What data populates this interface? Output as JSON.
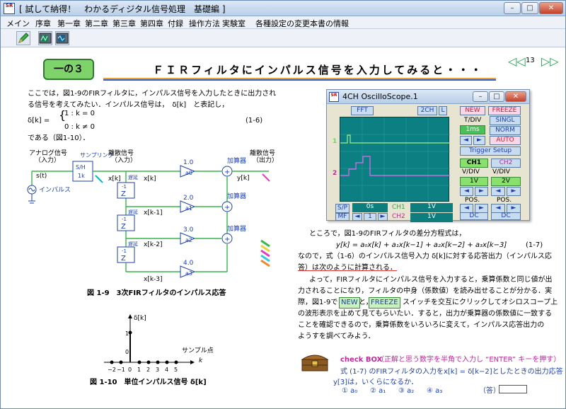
{
  "window": {
    "title": "[ 試して納得！　わかるディジタル信号処理　基礎編 ]",
    "app_icon_text": "SR",
    "buttons": [
      "minimize",
      "maximize",
      "close"
    ]
  },
  "menu": [
    "メイン",
    "序章",
    "第一章",
    "第二章",
    "第三章",
    "第四章",
    "付録",
    "操作方法",
    "実験室",
    "各種設定の変更",
    "本書の情報"
  ],
  "toolbar": [
    "pencil-tool",
    "scope-tool-1",
    "scope-tool-2"
  ],
  "page": {
    "chapter_badge": "一の３",
    "heading": "ＦＩＲフィルタにインパルス信号を入力してみると・・・",
    "page_number": "13",
    "nav_prev": "◁◁",
    "nav_next": "▷▷"
  },
  "left": {
    "p1_line1": "ここでは，図1-9のFIRフィルタに，インパルス信号を入力したときに出力され",
    "p1_line2": "る信号を考えてみたい．インパルス信号は，　δ[k]　と表記し，",
    "eq_lhs": "δ[k] =",
    "eq_case1": "1  : k = 0",
    "eq_case2": "0  : k ≠ 0",
    "eq_num": "(1-6)",
    "p1_end": "である（図1-10）．",
    "diagram": {
      "analog_label": "アナログ信号",
      "analog_sub": "（入力）",
      "sampling": "サンプリング",
      "discrete_in": "離散信号",
      "discrete_in_sub": "（入力）",
      "adder": "加算器",
      "discrete_out": "離散信号",
      "discrete_out_sub": "（出力）",
      "st": "s(t)",
      "impulse": "インパルス",
      "sh1": "S/H",
      "sh2": "1k",
      "xk": "x[k]",
      "xk1": "x[k-1]",
      "xk2": "x[k-2]",
      "xk3": "x[k-3]",
      "yk": "y[k]",
      "z": "Z",
      "z_exp": "-1",
      "delay": "遅延",
      "gains": [
        {
          "val": "1.0",
          "name": "a0"
        },
        {
          "val": "2.0",
          "name": "a1"
        },
        {
          "val": "3.0",
          "name": "a2"
        },
        {
          "val": "4.0",
          "name": "a3"
        }
      ],
      "plus": "+"
    },
    "fig9_caption": "図 1-9　3次FIRフィルタのインパルス応答",
    "stem": {
      "ylabel": "δ[k]",
      "xlabel": "サンプル点",
      "xvar": "k",
      "one": "1",
      "zero": "0",
      "ticks": [
        "−2",
        "−1",
        "0",
        "1",
        "2",
        "3",
        "4",
        "5"
      ]
    },
    "fig10_caption": "図 1-10　単位インパルス信号 δ[k]"
  },
  "scope": {
    "title": "4CH OscilloScope.1",
    "fft": "FFT",
    "ch2": "2CH",
    "l": "L",
    "new": "NEW",
    "freeze": "FREEZE",
    "tdiv_label": "T/DIV",
    "tdiv_val": "1ms",
    "singl": "SINGL",
    "norm": "NORM",
    "auto": "AUTO",
    "trigger": "Trigger Setup",
    "ch1_tab": "CH1",
    "ch2_tab": "CH2",
    "vdiv": "V/DIV",
    "v1": "1V",
    "v2": "2V",
    "pos": "POS.",
    "dc": "DC",
    "sp": "S/P",
    "mf": "MF",
    "time_off": "0s",
    "one": "1",
    "ch1_label": "CH1",
    "ch2_label": "CH2",
    "ch1_val": "1V",
    "ch2_val": "1V",
    "arrow_l": "◄",
    "arrow_r": "►",
    "marker1": "1",
    "marker2": "2"
  },
  "right": {
    "l1": "ところで，図1-9のFIRフィルタの差分方程式は，",
    "eq": "y[k] = a₀x[k] + a₁x[k−1] + a₂x[k−2] + a₃x[k−3]",
    "eq_num": "(1-7)",
    "l2": "なので，式（1-6）のインパルス信号入力 δ[k]に対する応答出力（インパルス応",
    "l3": "答）は次のように計算される．",
    "l4": "よって，FIRフィルタにインパルス信号を入力すると，乗算係数と同じ値が出",
    "l5": "力されることになり，フィルタの中身（係数値）を読み出せることが分かる．実",
    "l6a": "際，図1-9で",
    "new_btn": "NEW",
    "l6b": "と，",
    "freeze_btn": "FREEZE",
    "l6c": "スイッチを交互にクリックしてオシロスコープ上",
    "l7": "の波形表示を止めて見てもらいたい．すると，出力が乗算器の係数値に一致する",
    "l8": "ことを確認できるので，乗算係数をいろいろに変えて，インパルス応答出力の",
    "l9": "ようすを調べてみよう．",
    "check_title": "check BOX",
    "check_note": "（正解と思う数字を半角で入力し “ENTER” キーを押す）",
    "q1": "式 (1-7) のFIRフィルタの入力をx[k] = δ[k−2]としたときの出力応答",
    "q2": "y[3]は，いくらになるか．",
    "options": [
      "① a₀",
      "② a₁",
      "③ a₂",
      "④ a₃"
    ],
    "answer_label": "（答）",
    "colors": {
      "accent_blue": "#1c3fb0",
      "pink": "#c0279a",
      "green": "#7ed36a"
    }
  }
}
